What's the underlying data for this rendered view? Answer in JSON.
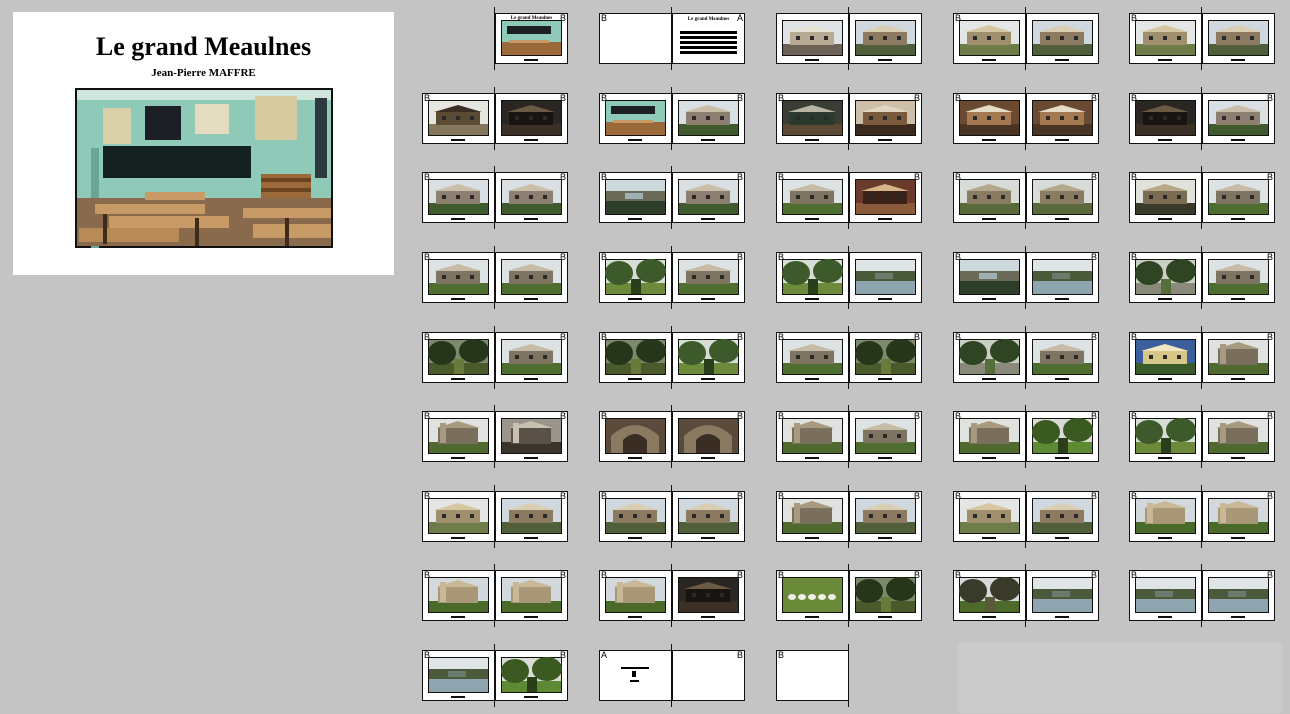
{
  "cover": {
    "title": "Le grand Meaulnes",
    "author": "Jean-Pierre MAFFRE"
  },
  "spread_title": "Le grand Meaulnes",
  "rows": [
    [
      {
        "left": "none",
        "right": {
          "label": "B",
          "kind": "title-thumb",
          "scene": "classroom"
        }
      },
      {
        "left": {
          "label": "B",
          "kind": "blank"
        },
        "right": {
          "label": "A",
          "kind": "title-text"
        }
      },
      {
        "left": {
          "label": "",
          "kind": "photo",
          "scene": "village"
        },
        "right": {
          "label": "",
          "kind": "photo",
          "scene": "houses"
        }
      },
      {
        "left": {
          "label": "B",
          "kind": "photo",
          "scene": "farm"
        },
        "right": {
          "label": "",
          "kind": "photo",
          "scene": "houses"
        }
      },
      {
        "left": {
          "label": "B",
          "kind": "photo",
          "scene": "farm"
        },
        "right": {
          "label": "",
          "kind": "photo",
          "scene": "houses"
        }
      }
    ],
    [
      {
        "left": {
          "label": "B",
          "kind": "photo",
          "scene": "barn"
        },
        "right": {
          "label": "B",
          "kind": "photo",
          "scene": "dark"
        }
      },
      {
        "left": {
          "label": "B",
          "kind": "photo",
          "scene": "classroom"
        },
        "right": {
          "label": "B",
          "kind": "photo",
          "scene": "manor"
        }
      },
      {
        "left": {
          "label": "B",
          "kind": "photo",
          "scene": "interior"
        },
        "right": {
          "label": "B",
          "kind": "photo",
          "scene": "stairs"
        }
      },
      {
        "left": {
          "label": "B",
          "kind": "photo",
          "scene": "bedroom"
        },
        "right": {
          "label": "B",
          "kind": "photo",
          "scene": "bedroom"
        }
      },
      {
        "left": {
          "label": "B",
          "kind": "photo",
          "scene": "dark"
        },
        "right": {
          "label": "B",
          "kind": "photo",
          "scene": "manor"
        }
      }
    ],
    [
      {
        "left": {
          "label": "B",
          "kind": "photo",
          "scene": "manor"
        },
        "right": {
          "label": "B",
          "kind": "photo",
          "scene": "manor"
        }
      },
      {
        "left": {
          "label": "B",
          "kind": "photo",
          "scene": "chateau-water"
        },
        "right": {
          "label": "B",
          "kind": "photo",
          "scene": "manor"
        }
      },
      {
        "left": {
          "label": "B",
          "kind": "photo",
          "scene": "chateau-lawn"
        },
        "right": {
          "label": "B",
          "kind": "photo",
          "scene": "corridor"
        }
      },
      {
        "left": {
          "label": "B",
          "kind": "photo",
          "scene": "courtyard"
        },
        "right": {
          "label": "B",
          "kind": "photo",
          "scene": "courtyard"
        }
      },
      {
        "left": {
          "label": "B",
          "kind": "photo",
          "scene": "arcade"
        },
        "right": {
          "label": "B",
          "kind": "photo",
          "scene": "chateau-lawn"
        }
      }
    ],
    [
      {
        "left": {
          "label": "B",
          "kind": "photo",
          "scene": "chateau-lawn"
        },
        "right": {
          "label": "B",
          "kind": "photo",
          "scene": "chateau-lawn"
        }
      },
      {
        "left": {
          "label": "B",
          "kind": "photo",
          "scene": "park"
        },
        "right": {
          "label": "B",
          "kind": "photo",
          "scene": "chateau-lawn"
        }
      },
      {
        "left": {
          "label": "B",
          "kind": "photo",
          "scene": "park"
        },
        "right": {
          "label": "",
          "kind": "photo",
          "scene": "lake"
        }
      },
      {
        "left": {
          "label": "B",
          "kind": "photo",
          "scene": "chateau-water"
        },
        "right": {
          "label": "B",
          "kind": "photo",
          "scene": "lake"
        }
      },
      {
        "left": {
          "label": "B",
          "kind": "photo",
          "scene": "path"
        },
        "right": {
          "label": "B",
          "kind": "photo",
          "scene": "chateau-lawn"
        }
      }
    ],
    [
      {
        "left": {
          "label": "B",
          "kind": "photo",
          "scene": "forest"
        },
        "right": {
          "label": "B",
          "kind": "photo",
          "scene": "chateau-lawn"
        }
      },
      {
        "left": {
          "label": "B",
          "kind": "photo",
          "scene": "forest"
        },
        "right": {
          "label": "B",
          "kind": "photo",
          "scene": "park"
        }
      },
      {
        "left": {
          "label": "B",
          "kind": "photo",
          "scene": "chateau-lawn"
        },
        "right": {
          "label": "B",
          "kind": "photo",
          "scene": "forest"
        }
      },
      {
        "left": {
          "label": "B",
          "kind": "photo",
          "scene": "path"
        },
        "right": {
          "label": "B",
          "kind": "photo",
          "scene": "chateau-lawn"
        }
      },
      {
        "left": {
          "label": "B",
          "kind": "photo",
          "scene": "house-blue"
        },
        "right": {
          "label": "B",
          "kind": "photo",
          "scene": "church"
        }
      }
    ],
    [
      {
        "left": {
          "label": "B",
          "kind": "photo",
          "scene": "church"
        },
        "right": {
          "label": "B",
          "kind": "photo",
          "scene": "cathedral"
        }
      },
      {
        "left": {
          "label": "B",
          "kind": "photo",
          "scene": "portal"
        },
        "right": {
          "label": "B",
          "kind": "photo",
          "scene": "portal"
        }
      },
      {
        "left": {
          "label": "B",
          "kind": "photo",
          "scene": "church"
        },
        "right": {
          "label": "B",
          "kind": "photo",
          "scene": "chateau-lawn"
        }
      },
      {
        "left": {
          "label": "B",
          "kind": "photo",
          "scene": "church"
        },
        "right": {
          "label": "B",
          "kind": "photo",
          "scene": "lawn"
        }
      },
      {
        "left": {
          "label": "B",
          "kind": "photo",
          "scene": "park"
        },
        "right": {
          "label": "B",
          "kind": "photo",
          "scene": "church"
        }
      }
    ],
    [
      {
        "left": {
          "label": "B",
          "kind": "photo",
          "scene": "farm"
        },
        "right": {
          "label": "B",
          "kind": "photo",
          "scene": "houses"
        }
      },
      {
        "left": {
          "label": "B",
          "kind": "photo",
          "scene": "houses"
        },
        "right": {
          "label": "B",
          "kind": "photo",
          "scene": "houses"
        }
      },
      {
        "left": {
          "label": "B",
          "kind": "photo",
          "scene": "church"
        },
        "right": {
          "label": "B",
          "kind": "photo",
          "scene": "houses"
        }
      },
      {
        "left": {
          "label": "B",
          "kind": "photo",
          "scene": "farm"
        },
        "right": {
          "label": "B",
          "kind": "photo",
          "scene": "houses"
        }
      },
      {
        "left": {
          "label": "B",
          "kind": "photo",
          "scene": "ruins"
        },
        "right": {
          "label": "B",
          "kind": "photo",
          "scene": "ruins"
        }
      }
    ],
    [
      {
        "left": {
          "label": "B",
          "kind": "photo",
          "scene": "ruins"
        },
        "right": {
          "label": "B",
          "kind": "photo",
          "scene": "ruins"
        }
      },
      {
        "left": {
          "label": "B",
          "kind": "photo",
          "scene": "ruins"
        },
        "right": {
          "label": "B",
          "kind": "photo",
          "scene": "dark"
        }
      },
      {
        "left": {
          "label": "B",
          "kind": "photo",
          "scene": "sheep"
        },
        "right": {
          "label": "B",
          "kind": "photo",
          "scene": "forest"
        }
      },
      {
        "left": {
          "label": "B",
          "kind": "photo",
          "scene": "tree"
        },
        "right": {
          "label": "B",
          "kind": "photo",
          "scene": "lake"
        }
      },
      {
        "left": {
          "label": "B",
          "kind": "photo",
          "scene": "lake"
        },
        "right": {
          "label": "B",
          "kind": "photo",
          "scene": "lake"
        }
      }
    ],
    [
      {
        "left": {
          "label": "B",
          "kind": "photo",
          "scene": "lake"
        },
        "right": {
          "label": "B",
          "kind": "photo",
          "scene": "lawn"
        }
      },
      {
        "left": {
          "label": "A",
          "kind": "colophon"
        },
        "right": {
          "label": "B",
          "kind": "blank"
        }
      },
      {
        "left": {
          "label": "B",
          "kind": "blank"
        },
        "right": "none"
      }
    ]
  ]
}
